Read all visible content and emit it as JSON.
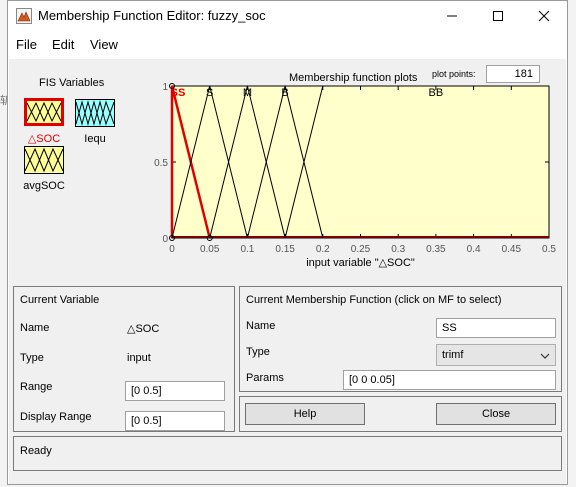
{
  "window": {
    "title": "Membership Function Editor: fuzzy_soc",
    "minimize_glyph": "—",
    "maximize_glyph": "☐",
    "close_glyph": "✕"
  },
  "menu": [
    {
      "label": "File"
    },
    {
      "label": "Edit"
    },
    {
      "label": "View"
    }
  ],
  "fis": {
    "title": "FIS Variables",
    "inputs": [
      {
        "label": "△SOC",
        "selected": true,
        "color": "#ffff99"
      },
      {
        "label": "avgSOC",
        "selected": false,
        "color": "#ffff99"
      }
    ],
    "outputs": [
      {
        "label": "Iequ",
        "selected": false,
        "color": "#99ffff"
      }
    ]
  },
  "plot": {
    "title": "Membership function plots",
    "points_label": "plot points:",
    "points_value": "181",
    "xlabel": "input variable \"△SOC\"",
    "xticks": [
      "0",
      "0.05",
      "0.1",
      "0.15",
      "0.2",
      "0.25",
      "0.3",
      "0.35",
      "0.4",
      "0.45",
      "0.5"
    ],
    "yticks": [
      "0",
      "0.5",
      "1"
    ],
    "mf_labels": [
      "SS",
      "S",
      "M",
      "B",
      "BB"
    ],
    "background": "#ffffcc",
    "selected_color": "#e00000"
  },
  "chart_data": {
    "type": "line",
    "xlabel": "input variable \"△SOC\"",
    "title": "Membership function plots",
    "xlim": [
      0,
      0.5
    ],
    "ylim": [
      0,
      1
    ],
    "series": [
      {
        "name": "SS",
        "x": [
          0,
          0,
          0.05
        ],
        "y": [
          0,
          1,
          0
        ],
        "selected": true
      },
      {
        "name": "S",
        "x": [
          0,
          0.05,
          0.1
        ],
        "y": [
          0,
          1,
          0
        ]
      },
      {
        "name": "M",
        "x": [
          0.05,
          0.1,
          0.15
        ],
        "y": [
          0,
          1,
          0
        ]
      },
      {
        "name": "B",
        "x": [
          0.1,
          0.15,
          0.2
        ],
        "y": [
          0,
          1,
          0
        ]
      },
      {
        "name": "BB",
        "x": [
          0.15,
          0.2,
          0.5
        ],
        "y": [
          0,
          1,
          1
        ]
      }
    ]
  },
  "current_variable": {
    "title": "Current Variable",
    "name_label": "Name",
    "name_value": "△SOC",
    "type_label": "Type",
    "type_value": "input",
    "range_label": "Range",
    "range_value": "[0 0.5]",
    "display_range_label": "Display Range",
    "display_range_value": "[0 0.5]"
  },
  "current_mf": {
    "title": "Current Membership Function (click on MF to select)",
    "name_label": "Name",
    "name_value": "SS",
    "type_label": "Type",
    "type_value": "trimf",
    "params_label": "Params",
    "params_value": "[0 0 0.05]"
  },
  "buttons": {
    "help": "Help",
    "close": "Close"
  },
  "status": "Ready"
}
